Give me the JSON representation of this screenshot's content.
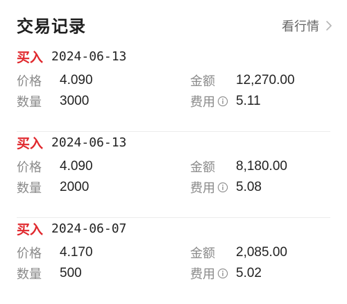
{
  "header": {
    "title": "交易记录",
    "quote_link": "看行情"
  },
  "labels": {
    "price": "价格",
    "quantity": "数量",
    "amount": "金额",
    "fee": "费用"
  },
  "records": [
    {
      "side": "买入",
      "date": "2024-06-13",
      "price": "4.090",
      "quantity": "3000",
      "amount": "12,270.00",
      "fee": "5.11"
    },
    {
      "side": "买入",
      "date": "2024-06-13",
      "price": "4.090",
      "quantity": "2000",
      "amount": "8,180.00",
      "fee": "5.08"
    },
    {
      "side": "买入",
      "date": "2024-06-07",
      "price": "4.170",
      "quantity": "500",
      "amount": "2,085.00",
      "fee": "5.02"
    }
  ],
  "colors": {
    "buy": "#e0282d",
    "label": "#8a8a8a",
    "text": "#222222"
  }
}
